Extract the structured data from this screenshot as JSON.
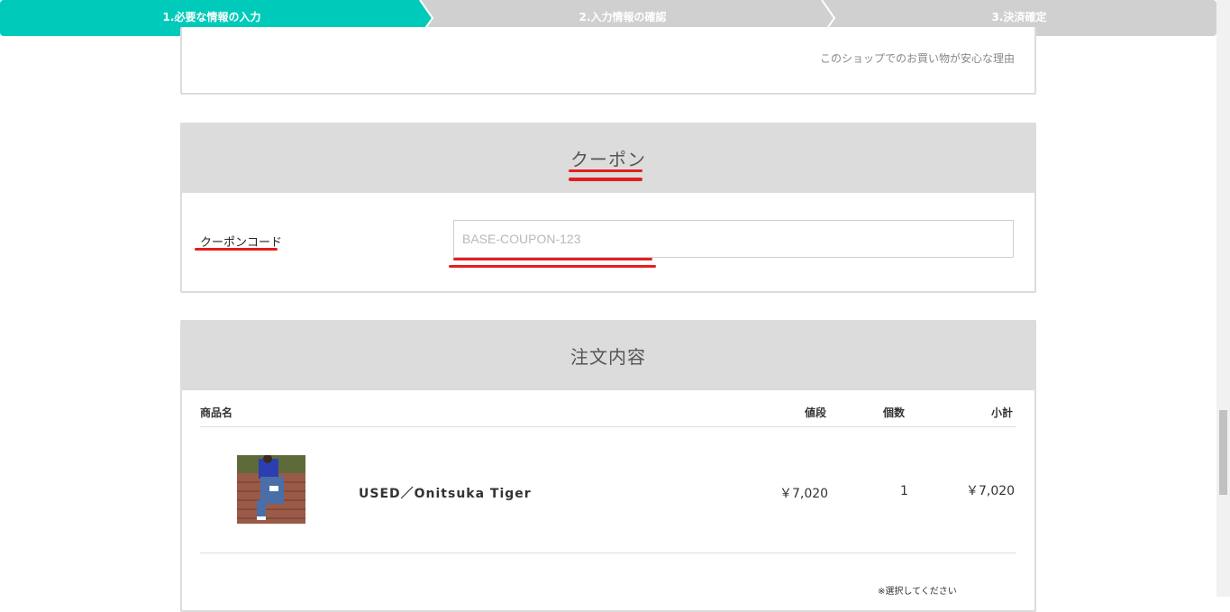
{
  "steps": {
    "step1": "1.必要な情報の入力",
    "step2": "2.入力情報の確認",
    "step3": "3.決済確定"
  },
  "shop_reason_link": "このショップでのお買い物が安心な理由",
  "coupon": {
    "title": "クーポン",
    "label": "クーポンコード",
    "placeholder": "BASE-COUPON-123",
    "value": ""
  },
  "order": {
    "title": "注文内容",
    "headers": {
      "name": "商品名",
      "price": "値段",
      "qty": "個数",
      "subtotal": "小計"
    },
    "items": [
      {
        "name": "USED／Onitsuka Tiger",
        "price": "￥7,020",
        "qty": "1",
        "subtotal": "￥7,020"
      }
    ],
    "select_note": "※選択してください"
  },
  "colors": {
    "accent": "#00cbbb",
    "step_inactive": "#d0d0d0",
    "annotation_red": "#e41e1e"
  }
}
